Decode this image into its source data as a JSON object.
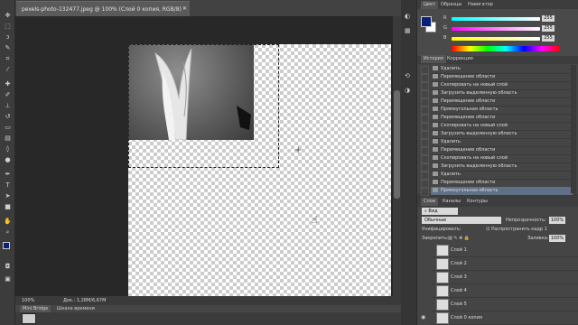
{
  "document": {
    "tab_title": "pexels-photo-132477.jpeg @ 100% (Слой 0 копия, RGB/8) *",
    "close": "×"
  },
  "status": {
    "zoom": "100%",
    "doc_info": "Док.: 1,28M/6,67M"
  },
  "bottom_tabs": [
    "Mini Bridge",
    "Шкала времени"
  ],
  "toolbar": {
    "tools": [
      "move-icon",
      "marquee-icon",
      "lasso-icon",
      "quick-select-icon",
      "crop-icon",
      "eyedropper-icon",
      "healing-icon",
      "brush-icon",
      "stamp-icon",
      "history-brush-icon",
      "eraser-icon",
      "gradient-icon",
      "blur-icon",
      "dodge-icon",
      "pen-icon",
      "type-icon",
      "path-select-icon",
      "shape-icon",
      "hand-icon",
      "zoom-icon"
    ]
  },
  "color_panel": {
    "tabs": [
      "Цвет",
      "Образцы",
      "Навигатор"
    ],
    "r_label": "R",
    "g_label": "G",
    "b_label": "B",
    "r": "255",
    "g": "255",
    "b": "255",
    "foreground": "#08227a",
    "background": "#ffffff"
  },
  "history_panel": {
    "tabs": [
      "История",
      "Коррекция"
    ],
    "items": [
      "Удалить",
      "Перемещение области",
      "Скопировать на новый слой",
      "Загрузить выделенную область",
      "Перемещение области",
      "Прямоугольная область",
      "Перемещение области",
      "Скопировать на новый слой",
      "Загрузить выделенную область",
      "Удалить",
      "Перемещение области",
      "Скопировать на новый слой",
      "Загрузить выделенную область",
      "Удалить",
      "Перемещение области",
      "Прямоугольная область"
    ]
  },
  "layers_panel": {
    "tabs": [
      "Слои",
      "Каналы",
      "Контуры"
    ],
    "filter": "Вид",
    "blend_mode": "Обычные",
    "opacity_label": "Непрозрачность:",
    "opacity": "100%",
    "unify_label": "Унифицировать:",
    "propagate_label": "Распространить кадр 1",
    "lock_label": "Закрепить:",
    "fill_label": "Заливка:",
    "fill": "100%",
    "layers": [
      "Слой 1",
      "Слой 2",
      "Слой 3",
      "Слой 4",
      "Слой 5",
      "Слой 0 копия"
    ]
  }
}
